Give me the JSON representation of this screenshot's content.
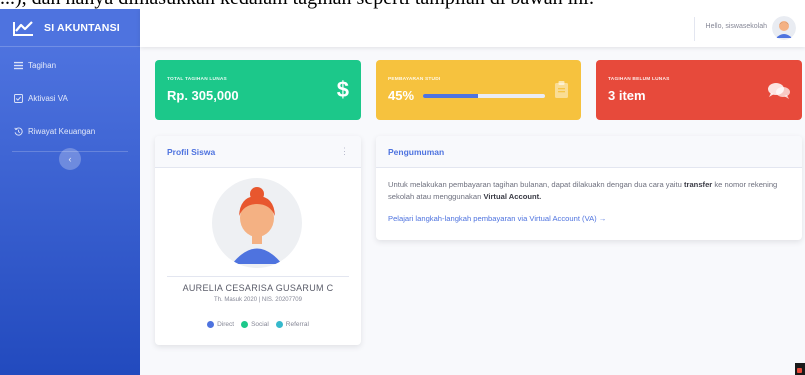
{
  "doc_fragment": "...), dan hanya dimasukkan kedalam tagihan seperti tampilan di bawah ini:",
  "app": {
    "brand": "SI AKUNTANSI"
  },
  "sidebar": {
    "items": [
      {
        "label": "Tagihan",
        "icon": "list-icon"
      },
      {
        "label": "Aktivasi VA",
        "icon": "check-square-icon"
      },
      {
        "label": "Riwayat Keuangan",
        "icon": "history-icon"
      }
    ],
    "toggle_icon": "chevron-left-icon"
  },
  "topbar": {
    "greeting": "Hello, siswasekolah"
  },
  "stats": {
    "total_paid": {
      "label": "TOTAL TAGIHAN LUNAS",
      "value": "Rp. 305,000",
      "icon": "dollar-icon",
      "color": "#1cc88a"
    },
    "study_payment": {
      "label": "PEMBAYARAN STUDI",
      "value": "45%",
      "progress": 0.45,
      "icon": "clipboard-icon",
      "color": "#f6c23e"
    },
    "unpaid": {
      "label": "TAGIHAN BELUM LUNAS",
      "value": "3 item",
      "icon": "comments-icon",
      "color": "#e74a3b"
    }
  },
  "profile": {
    "title": "Profil Siswa",
    "name": "AURELIA CESARISA GUSARUM C",
    "meta": "Th. Masuk 2020 | NIS. 20207709",
    "legend": [
      {
        "label": "Direct",
        "color": "#4e73df"
      },
      {
        "label": "Social",
        "color": "#1cc88a"
      },
      {
        "label": "Referral",
        "color": "#36b9cc"
      }
    ]
  },
  "announcement": {
    "title": "Pengumuman",
    "text_1": "Untuk melakukan pembayaran tagihan bulanan, dapat dilakuakn dengan dua cara yaitu",
    "bold_1": "transfer",
    "text_2": "ke nomor rekening sekolah atau menggunakan",
    "bold_2": "Virtual Account.",
    "link": "Pelajari langkah-langkah pembayaran via Virtual Account (VA) →"
  },
  "colors": {
    "primary": "#4e73df",
    "success": "#1cc88a",
    "warning": "#f6c23e",
    "danger": "#e74a3b"
  }
}
